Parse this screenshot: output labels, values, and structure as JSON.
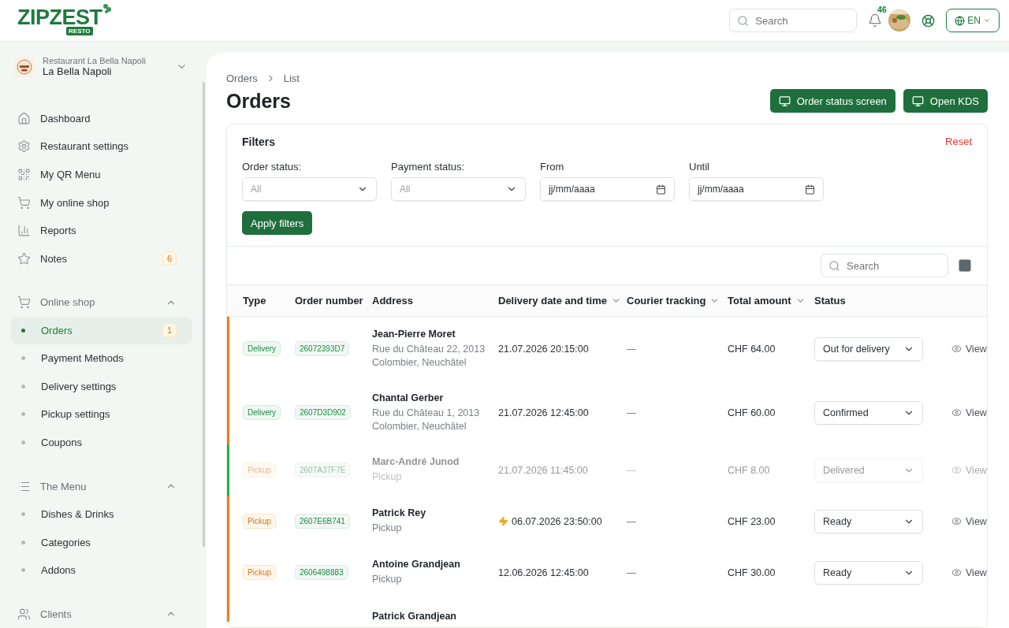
{
  "header": {
    "logo": "ZIPZEST",
    "logo_badge": "RESTO",
    "search": {
      "placeholder": "Search"
    },
    "notification_count": "46",
    "language": "EN"
  },
  "restaurant": {
    "subtitle": "Restaurant La Bella Napoli",
    "name": "La Bella Napoli"
  },
  "sidebar": {
    "items": [
      {
        "label": "Dashboard",
        "selected": false
      },
      {
        "label": "Restaurant settings",
        "selected": false
      },
      {
        "label": "My QR Menu",
        "selected": false
      },
      {
        "label": "My online shop",
        "selected": false
      },
      {
        "label": "Reports",
        "selected": false
      },
      {
        "label": "Notes",
        "selected": false,
        "badge": "6"
      }
    ],
    "groups": [
      {
        "label": "Online shop",
        "expanded": true,
        "children": [
          {
            "label": "Orders",
            "selected": true,
            "badge": "1"
          },
          {
            "label": "Payment Methods",
            "selected": false
          },
          {
            "label": "Delivery settings",
            "selected": false
          },
          {
            "label": "Pickup settings",
            "selected": false
          },
          {
            "label": "Coupons",
            "selected": false
          }
        ]
      },
      {
        "label": "The Menu",
        "expanded": true,
        "children": [
          {
            "label": "Dishes & Drinks",
            "selected": false
          },
          {
            "label": "Categories",
            "selected": false
          },
          {
            "label": "Addons",
            "selected": false
          }
        ]
      },
      {
        "label": "Clients",
        "expanded": true
      }
    ]
  },
  "breadcrumb": [
    "Orders",
    "List"
  ],
  "page_title": "Orders",
  "actions": [
    "Order status screen",
    "Open KDS"
  ],
  "filters": {
    "title": "Filters",
    "reset": "Reset",
    "fields": [
      {
        "label": "Order status:",
        "kind": "select",
        "value": "All"
      },
      {
        "label": "Payment status:",
        "kind": "select",
        "value": "All"
      },
      {
        "label": "From",
        "kind": "date",
        "placeholder": "jj/mm/aaaa"
      },
      {
        "label": "Until",
        "kind": "date",
        "placeholder": "jj/mm/aaaa"
      }
    ],
    "apply": "Apply filters"
  },
  "table": {
    "search": {
      "placeholder": "Search"
    },
    "columns": [
      {
        "label": "Type",
        "sortable": false
      },
      {
        "label": "Order number",
        "sortable": false
      },
      {
        "label": "Address",
        "sortable": false
      },
      {
        "label": "Delivery date and time",
        "sortable": true
      },
      {
        "label": "Courier tracking",
        "sortable": true
      },
      {
        "label": "Total amount",
        "sortable": true
      },
      {
        "label": "Status",
        "sortable": false
      }
    ],
    "rows": [
      {
        "kind": "delivery",
        "type": "Delivery",
        "order_number": "26072393D7",
        "customer": "Jean-Pierre Moret",
        "address": "Rue du Château 22, 2013 Colombier, Neuchâtel",
        "datetime": "21.07.2026 20:15:00",
        "urgent": false,
        "courier": "—",
        "total": "CHF 64.00",
        "status": "Out for delivery",
        "muted": false,
        "color": "#f07e1b",
        "action": "View"
      },
      {
        "kind": "delivery",
        "type": "Delivery",
        "order_number": "2607D3D902",
        "customer": "Chantal Gerber",
        "address": "Rue du Château 1, 2013 Colombier, Neuchâtel",
        "datetime": "21.07.2026 12:45:00",
        "urgent": false,
        "courier": "—",
        "total": "CHF 60.00",
        "status": "Confirmed",
        "muted": false,
        "color": "#f07e1b",
        "action": "View"
      },
      {
        "kind": "pickup",
        "type": "Pickup",
        "order_number": "2607A37F7E",
        "customer": "Marc-André Junod",
        "address": "Pickup",
        "datetime": "21.07.2026 11:45:00",
        "urgent": false,
        "courier": "—",
        "total": "CHF 8.00",
        "status": "Delivered",
        "muted": true,
        "color": "#22b14c",
        "action": "View"
      },
      {
        "kind": "pickup",
        "type": "Pickup",
        "order_number": "2607E6B741",
        "customer": "Patrick Rey",
        "address": "Pickup",
        "datetime": "06.07.2026 23:50:00",
        "urgent": true,
        "courier": "—",
        "total": "CHF 23.00",
        "status": "Ready",
        "muted": false,
        "color": "#f07e1b",
        "action": "View"
      },
      {
        "kind": "pickup",
        "type": "Pickup",
        "order_number": "2606498883",
        "customer": "Antoine Grandjean",
        "address": "Pickup",
        "datetime": "12.06.2026 12:45:00",
        "urgent": false,
        "courier": "—",
        "total": "CHF 30.00",
        "status": "Ready",
        "muted": false,
        "color": "#f07e1b",
        "action": "View"
      },
      {
        "kind": "partial",
        "customer": "Patrick Grandjean",
        "color": "#f07e1b"
      }
    ]
  }
}
